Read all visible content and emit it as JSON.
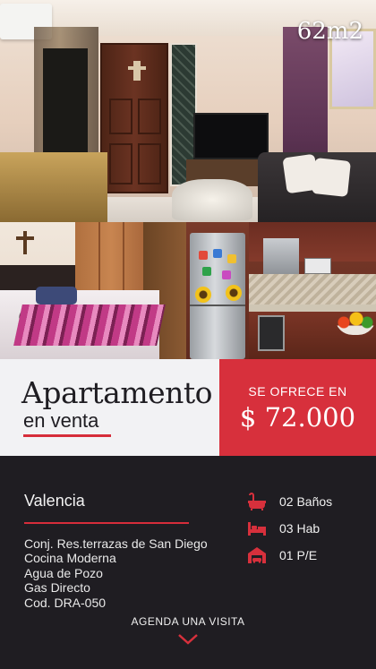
{
  "listing": {
    "size": "62m2",
    "title_line1": "Apartamento",
    "title_line2": "en venta",
    "price_label": "SE OFRECE EN",
    "price": "$ 72.000",
    "city": "Valencia",
    "details": [
      "Conj. Res.terrazas de San Diego",
      "Cocina Moderna",
      "Agua de Pozo",
      "Gas Directo",
      "Cod. DRA-050"
    ],
    "features": [
      {
        "icon": "bathtub-icon",
        "text": "02 Baños"
      },
      {
        "icon": "bed-icon",
        "text": "03 Hab"
      },
      {
        "icon": "garage-icon",
        "text": "01 P/E"
      }
    ],
    "cta": "AGENDA UNA VISITA"
  },
  "colors": {
    "accent_red": "#d7303c",
    "dark_bg": "#1f1d22",
    "light_bg": "#f2f2f4"
  }
}
